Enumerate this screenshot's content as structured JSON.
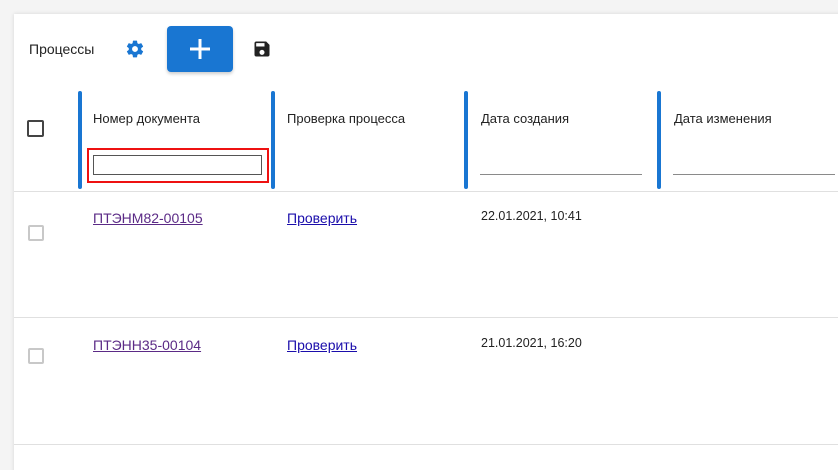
{
  "toolbar": {
    "title": "Процессы",
    "icons": [
      "gear-icon",
      "plus-icon",
      "save-icon"
    ]
  },
  "colors": {
    "accent": "#1976d2",
    "highlight": "#ee1111",
    "visited_link": "#5b2a86",
    "link": "#1a0dab"
  },
  "table": {
    "columns": [
      {
        "label": "Номер документа"
      },
      {
        "label": "Проверка процесса"
      },
      {
        "label": "Дата создания"
      },
      {
        "label": "Дата изменения"
      }
    ],
    "filter": {
      "value": "",
      "placeholder": ""
    },
    "rows": [
      {
        "doc": "ПТЭНМ82-00105",
        "check": "Проверить",
        "created": "22.01.2021, 10:41",
        "modified": ""
      },
      {
        "doc": "ПТЭНН35-00104",
        "check": "Проверить",
        "created": "21.01.2021, 16:20",
        "modified": ""
      }
    ]
  }
}
